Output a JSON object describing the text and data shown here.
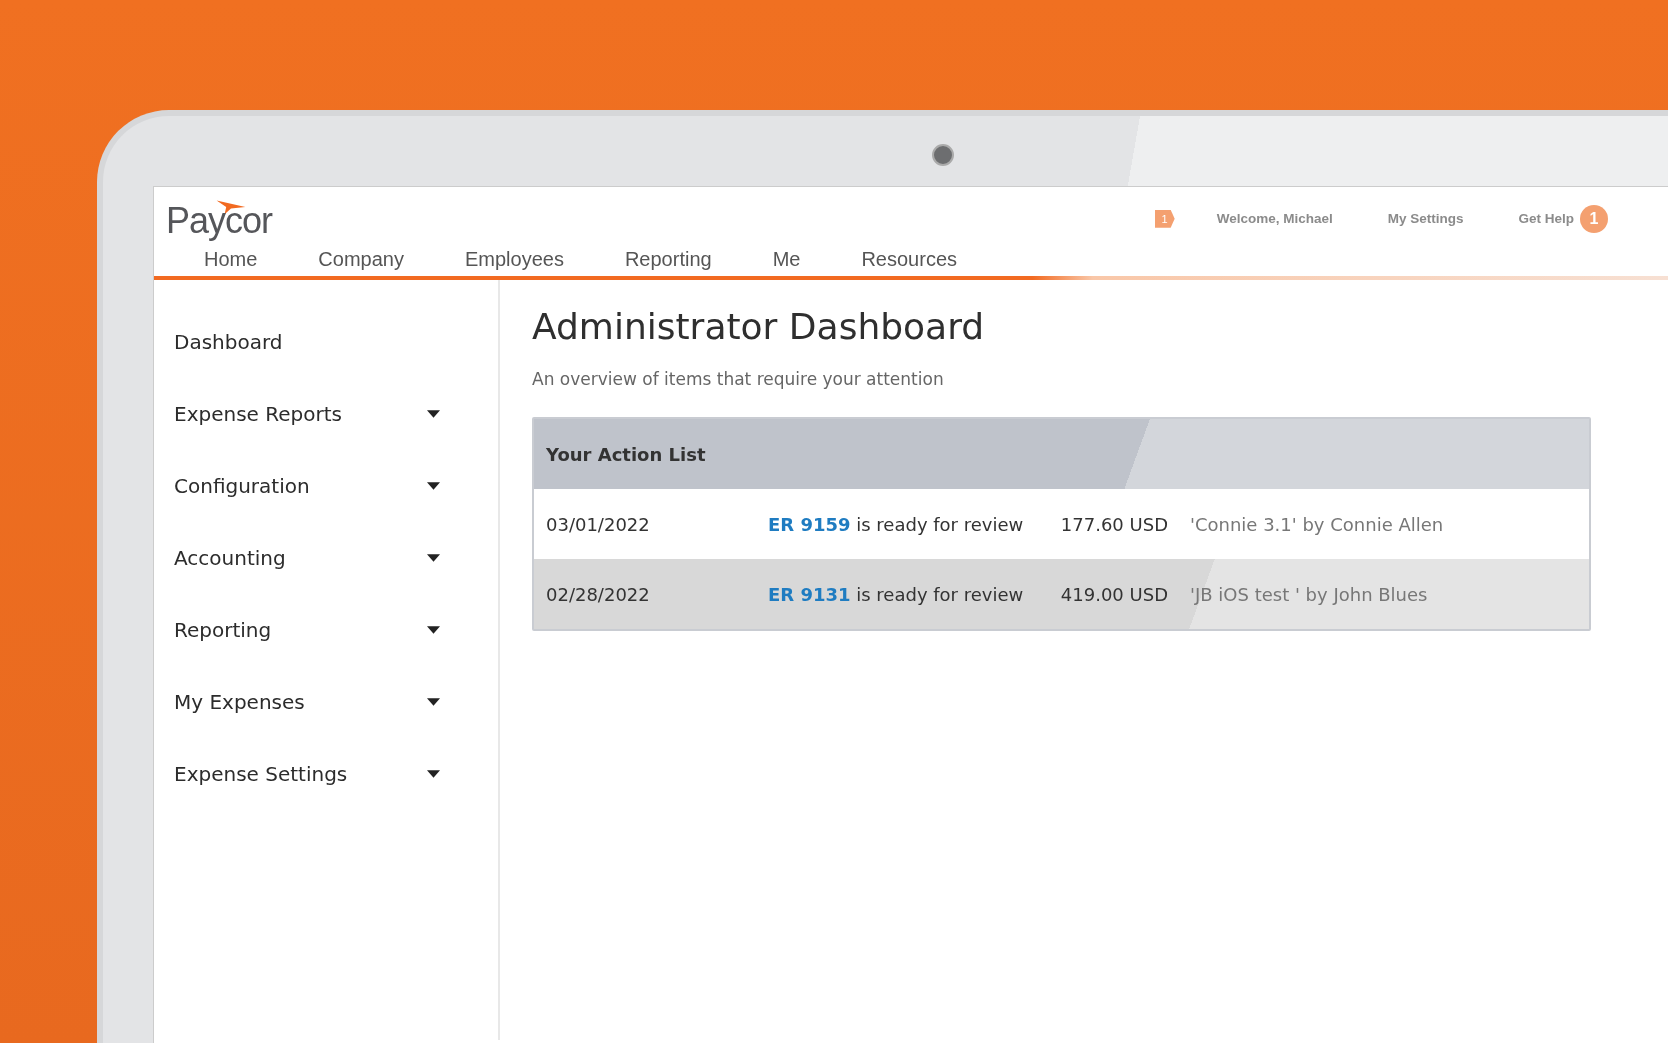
{
  "header": {
    "logo": "Paycor",
    "notification_count": "1",
    "welcome": "Welcome, Michael",
    "settings_link": "My Settings",
    "help_link": "Get Help",
    "help_count": "1"
  },
  "nav": [
    {
      "label": "Home"
    },
    {
      "label": "Company"
    },
    {
      "label": "Employees"
    },
    {
      "label": "Reporting"
    },
    {
      "label": "Me"
    },
    {
      "label": "Resources"
    }
  ],
  "sidebar": {
    "items": [
      {
        "label": "Dashboard",
        "kind": "link"
      },
      {
        "label": "Expense Reports",
        "kind": "menu"
      },
      {
        "label": "Configuration",
        "kind": "menu"
      },
      {
        "label": "Accounting",
        "kind": "menu"
      },
      {
        "label": "Reporting",
        "kind": "menu"
      },
      {
        "label": "My Expenses",
        "kind": "menu"
      },
      {
        "label": "Expense Settings",
        "kind": "menu"
      }
    ]
  },
  "page": {
    "title": "Administrator Dashboard",
    "subtitle": "An overview of items that require your attention"
  },
  "action_list": {
    "title": "Your Action List",
    "rows": [
      {
        "date": "03/01/2022",
        "report": "ER 9159",
        "message": "is ready for review",
        "amount": "177.60 USD",
        "description": "'Connie 3.1' by Connie Allen"
      },
      {
        "date": "02/28/2022",
        "report": "ER 9131",
        "message": "is ready for review",
        "amount": "419.00 USD",
        "description": "'JB iOS test ' by John Blues"
      }
    ]
  }
}
